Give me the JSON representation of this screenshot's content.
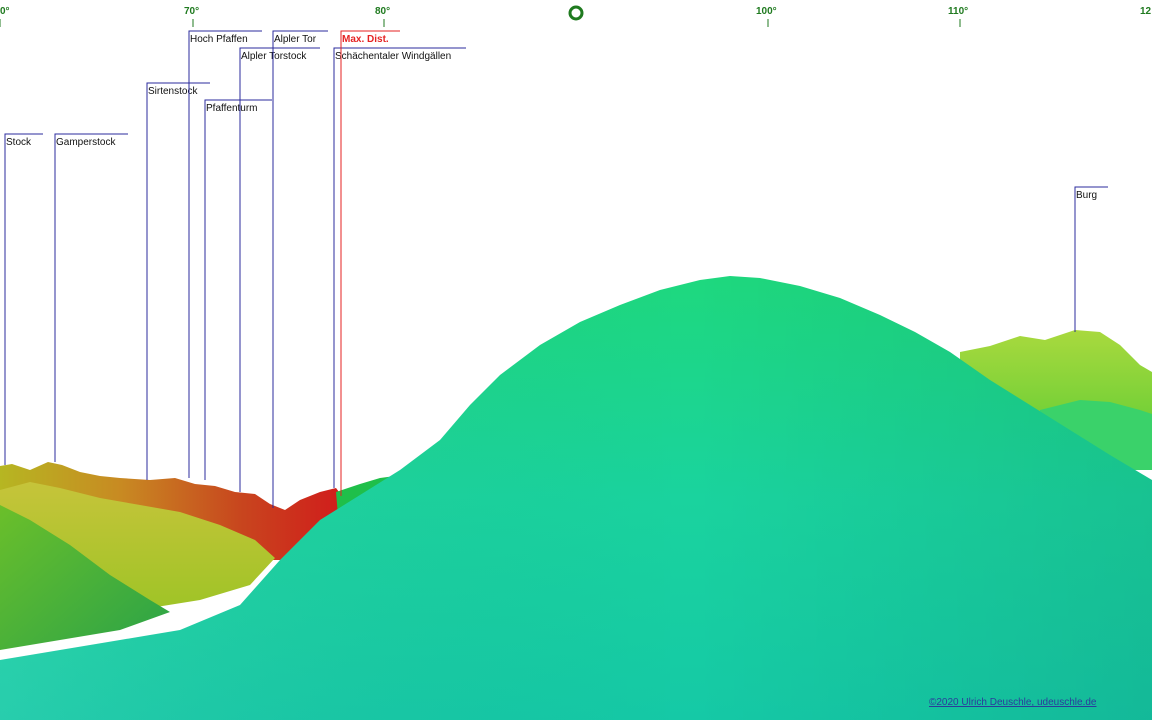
{
  "compass": {
    "ticks": [
      "0°",
      "70°",
      "80°",
      "100°",
      "110°",
      "12"
    ],
    "north_marker": "O"
  },
  "peaks": [
    {
      "name": "Stock"
    },
    {
      "name": "Gamperstock"
    },
    {
      "name": "Sirtenstock"
    },
    {
      "name": "Hoch Pfaffen"
    },
    {
      "name": "Pfaffenturm"
    },
    {
      "name": "Alpler Torstock"
    },
    {
      "name": "Alpler Tor"
    },
    {
      "name": "Schächentaler Windgällen"
    },
    {
      "name": "Burg"
    }
  ],
  "max_dist": {
    "label": "Max. Dist."
  },
  "copyright": "©2020 Ulrich Deuschle, udeuschle.de",
  "colors": {
    "label_line": "#2b2b9c",
    "max_dist": "#e52222",
    "compass": "#1f7a1f",
    "near_hill": "#1ed89c",
    "far_ridge_hot": "#c81e1e",
    "far_ridge_warm": "#c8a020",
    "right_ridge": "#8ed63c"
  }
}
